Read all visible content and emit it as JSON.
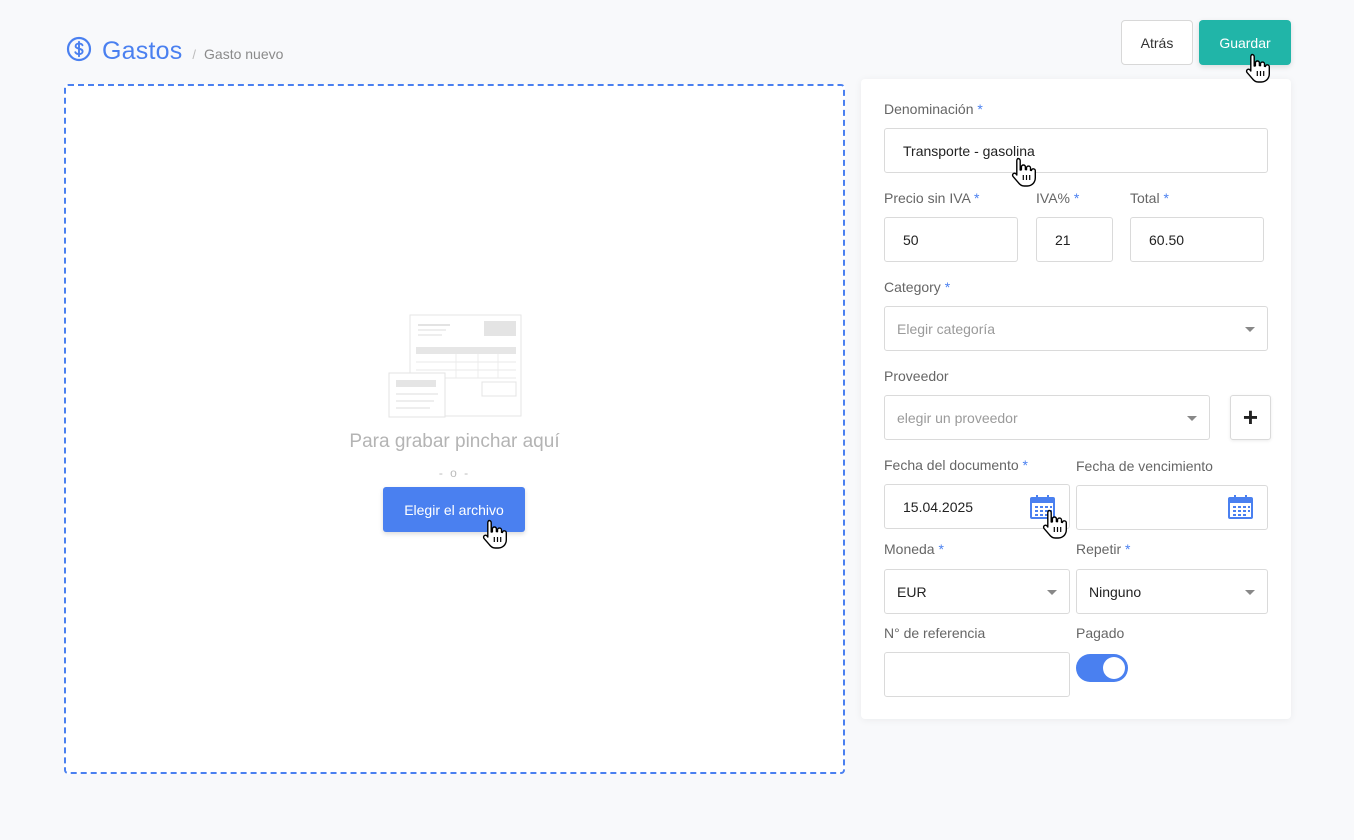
{
  "header": {
    "title": "Gastos",
    "separator": "/",
    "breadcrumb": "Gasto nuevo",
    "icon": "dollar-circle-icon"
  },
  "actions": {
    "back_label": "Atrás",
    "save_label": "Guardar"
  },
  "dropzone": {
    "text": "Para grabar pinchar aquí",
    "or": "- o -",
    "button_label": "Elegir el archivo"
  },
  "form": {
    "denominacion": {
      "label": "Denominación",
      "value": "Transporte - gasolina"
    },
    "precio": {
      "label": "Precio sin IVA",
      "value": "50"
    },
    "iva": {
      "label": "IVA%",
      "value": "21"
    },
    "total": {
      "label": "Total",
      "value": "60.50"
    },
    "category": {
      "label": "Category",
      "placeholder": "Elegir categoría"
    },
    "proveedor": {
      "label": "Proveedor",
      "placeholder": "elegir un proveedor",
      "add_label": "+"
    },
    "fecha_documento": {
      "label": "Fecha del documento",
      "value": "15.04.2025"
    },
    "fecha_vencimiento": {
      "label": "Fecha de vencimiento",
      "value": ""
    },
    "moneda": {
      "label": "Moneda",
      "value": "EUR"
    },
    "repetir": {
      "label": "Repetir",
      "value": "Ninguno"
    },
    "referencia": {
      "label": "N° de referencia",
      "value": ""
    },
    "pagado": {
      "label": "Pagado",
      "checked": true
    },
    "required_mark": "*"
  },
  "colors": {
    "accent": "#4a80f0",
    "save": "#21b5a8",
    "background": "#f8f9fb"
  }
}
